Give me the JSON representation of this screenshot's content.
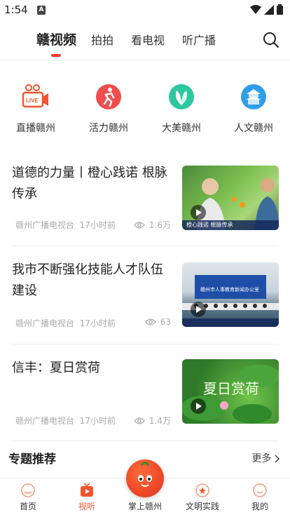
{
  "status": {
    "time": "1:54",
    "a_badge": "A"
  },
  "tabs": [
    {
      "label": "赣视频",
      "active": true
    },
    {
      "label": "拍拍",
      "active": false
    },
    {
      "label": "看电视",
      "active": false
    },
    {
      "label": "听广播",
      "active": false
    }
  ],
  "categories": [
    {
      "label": "直播赣州",
      "icon": "live-icon",
      "color": "#f2542d"
    },
    {
      "label": "活力赣州",
      "icon": "running-icon",
      "color": "#f04e4e"
    },
    {
      "label": "大美赣州",
      "icon": "leaf-icon",
      "color": "#2cc7a0"
    },
    {
      "label": "人文赣州",
      "icon": "pagoda-icon",
      "color": "#2f9ee8"
    }
  ],
  "news": [
    {
      "title": "道德的力量丨橙心践诺 根脉传承",
      "source": "赣州广播电视台",
      "time": "17小时前",
      "views": "1.6万",
      "thumb_caption": "橙心践诺 根脉传承"
    },
    {
      "title": "我市不断强化技能人才队伍建设",
      "source": "赣州广播电视台",
      "time": "17小时前",
      "views": "63",
      "thumb_caption": "赣州市人事教育新闻办公室"
    },
    {
      "title": "信丰：夏日赏荷",
      "source": "赣州广播电视台",
      "time": "17小时前",
      "views": "1.4万",
      "thumb_caption": "夏日赏荷"
    }
  ],
  "section": {
    "title": "专题推荐",
    "more": "更多"
  },
  "bottom_nav": [
    {
      "label": "首页",
      "icon": "home-icon",
      "active": false
    },
    {
      "label": "视听",
      "icon": "tv-icon",
      "active": true
    },
    {
      "label": "掌上赣州",
      "icon": "mascot-icon",
      "active": false
    },
    {
      "label": "文明实践",
      "icon": "star-badge-icon",
      "active": false
    },
    {
      "label": "我的",
      "icon": "profile-icon",
      "active": false
    }
  ],
  "colors": {
    "accent": "#f03c2a",
    "active_nav": "#f2542d"
  }
}
